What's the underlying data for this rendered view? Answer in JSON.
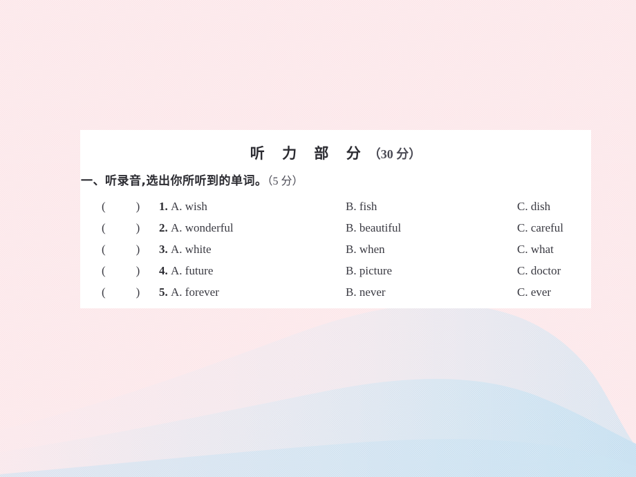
{
  "page": {
    "background_color": "#fce5e9",
    "wave_color": "#cfe4f1",
    "paper_color": "#ffffff",
    "text_color": "#3a3a42"
  },
  "paper": {
    "title_cn": "听 力 部 分",
    "title_score": "（30 分）",
    "section": {
      "heading_cn": "一、听录音,选出你所听到的单词。",
      "heading_score": "（5 分）"
    },
    "blank": {
      "open": "(",
      "close": ")"
    },
    "questions": [
      {
        "number": "1.",
        "a_letter": "A.",
        "a_word": "wish",
        "b_letter": "B.",
        "b_word": "fish",
        "c_letter": "C.",
        "c_word": "dish"
      },
      {
        "number": "2.",
        "a_letter": "A.",
        "a_word": "wonderful",
        "b_letter": "B.",
        "b_word": "beautiful",
        "c_letter": "C.",
        "c_word": "careful"
      },
      {
        "number": "3.",
        "a_letter": "A.",
        "a_word": "white",
        "b_letter": "B.",
        "b_word": "when",
        "c_letter": "C.",
        "c_word": "what"
      },
      {
        "number": "4.",
        "a_letter": "A.",
        "a_word": "future",
        "b_letter": "B.",
        "b_word": "picture",
        "c_letter": "C.",
        "c_word": "doctor"
      },
      {
        "number": "5.",
        "a_letter": "A.",
        "a_word": "forever",
        "b_letter": "B.",
        "b_word": "never",
        "c_letter": "C.",
        "c_word": "ever"
      }
    ]
  }
}
